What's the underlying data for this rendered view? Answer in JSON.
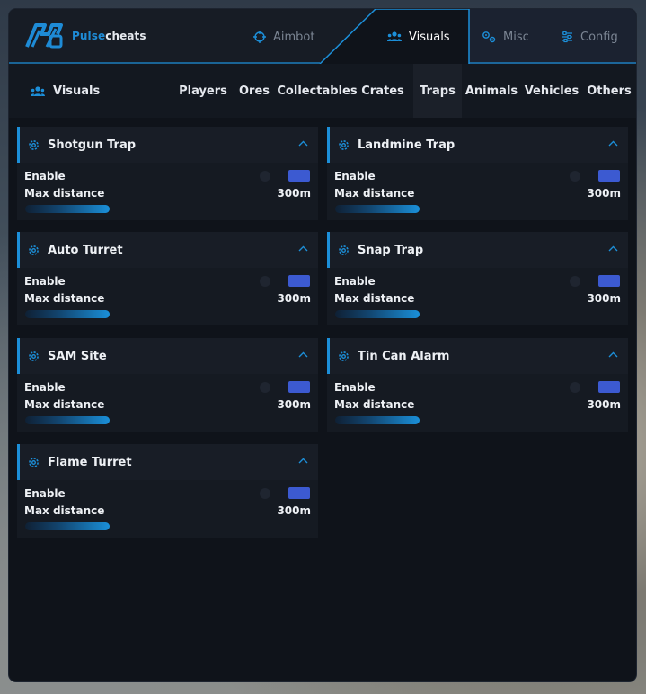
{
  "brand": {
    "part1": "Pulse",
    "part2": "cheats"
  },
  "top_tabs": [
    {
      "label": "Aimbot",
      "icon": "crosshair-icon",
      "active": false
    },
    {
      "label": "Visuals",
      "icon": "users-icon",
      "active": true
    },
    {
      "label": "Misc",
      "icon": "gears-icon",
      "active": false
    },
    {
      "label": "Config",
      "icon": "sliders-icon",
      "active": false
    }
  ],
  "subnav": {
    "title": "Visuals",
    "tabs": [
      {
        "label": "Players"
      },
      {
        "label": "Ores"
      },
      {
        "label": "Collectables"
      },
      {
        "label": "Crates"
      },
      {
        "label": "Traps",
        "active": true
      },
      {
        "label": "Animals"
      },
      {
        "label": "Vehicles"
      },
      {
        "label": "Others"
      }
    ]
  },
  "cards": [
    {
      "name": "Shotgun Trap",
      "enable_label": "Enable",
      "distance_label": "Max distance",
      "distance_value": "300m"
    },
    {
      "name": "Landmine Trap",
      "enable_label": "Enable",
      "distance_label": "Max distance",
      "distance_value": "300m"
    },
    {
      "name": "Auto Turret",
      "enable_label": "Enable",
      "distance_label": "Max distance",
      "distance_value": "300m"
    },
    {
      "name": "Snap Trap",
      "enable_label": "Enable",
      "distance_label": "Max distance",
      "distance_value": "300m"
    },
    {
      "name": "SAM Site",
      "enable_label": "Enable",
      "distance_label": "Max distance",
      "distance_value": "300m"
    },
    {
      "name": "Tin Can Alarm",
      "enable_label": "Enable",
      "distance_label": "Max distance",
      "distance_value": "300m"
    },
    {
      "name": "Flame Turret",
      "enable_label": "Enable",
      "distance_label": "Max distance",
      "distance_value": "300m"
    }
  ],
  "colors": {
    "accent": "#1c8fd9",
    "toggle_on": "#3c5ad1",
    "panel": "#0f131a"
  }
}
